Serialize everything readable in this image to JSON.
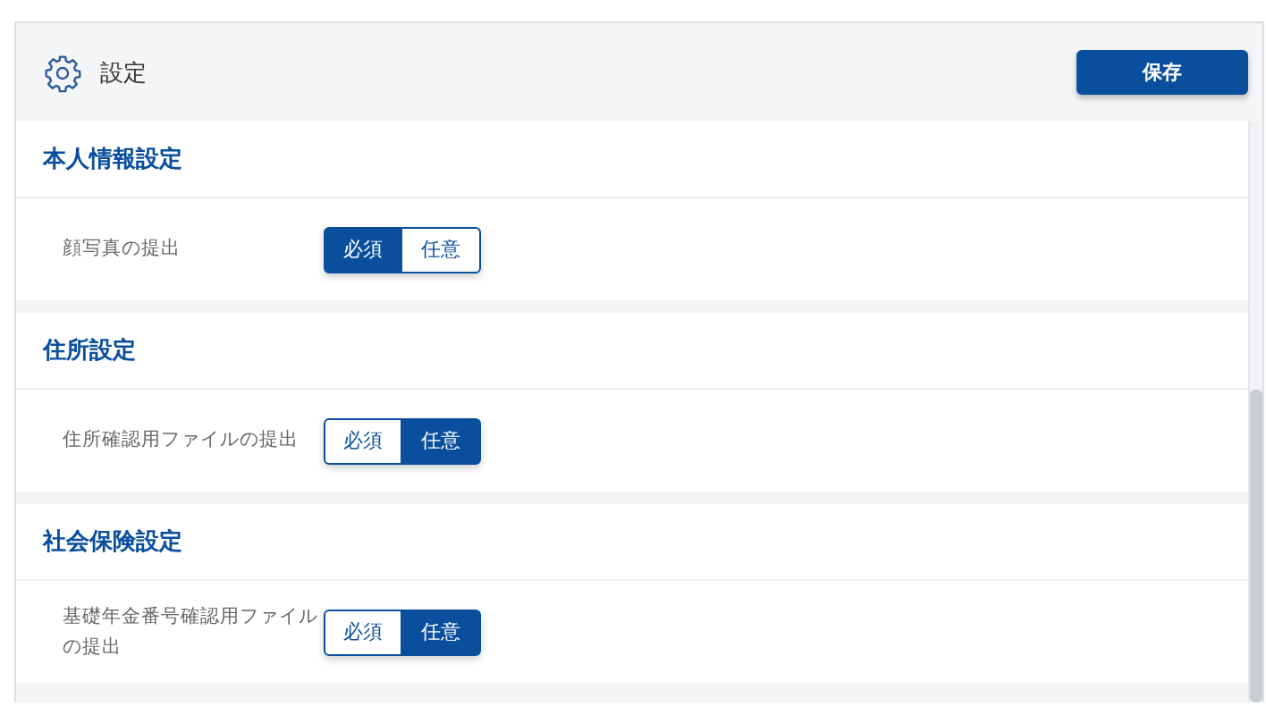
{
  "header": {
    "title": "設定",
    "save_button": "保存"
  },
  "sections": [
    {
      "title": "本人情報設定",
      "rows": [
        {
          "label": "顔写真の提出",
          "options": [
            {
              "label": "必須",
              "selected": true
            },
            {
              "label": "任意",
              "selected": false
            }
          ]
        }
      ]
    },
    {
      "title": "住所設定",
      "rows": [
        {
          "label": "住所確認用ファイルの提出",
          "options": [
            {
              "label": "必須",
              "selected": false
            },
            {
              "label": "任意",
              "selected": true
            }
          ]
        }
      ]
    },
    {
      "title": "社会保険設定",
      "rows": [
        {
          "label": "基礎年金番号確認用ファイルの提出",
          "options": [
            {
              "label": "必須",
              "selected": false
            },
            {
              "label": "任意",
              "selected": true
            }
          ]
        }
      ]
    }
  ]
}
